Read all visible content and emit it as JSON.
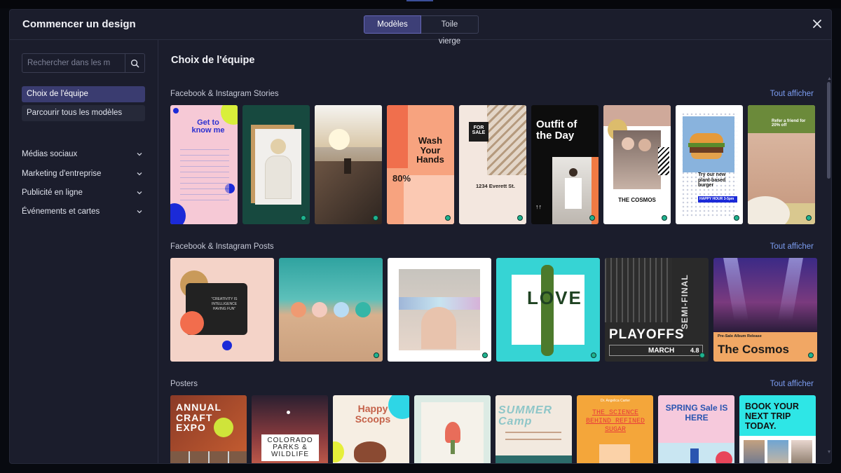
{
  "modal": {
    "title": "Commencer un design",
    "tabs": [
      "Modèles",
      "Toile vierge"
    ]
  },
  "sidebar": {
    "search_placeholder": "Rechercher dans les m",
    "items": [
      "Choix de l'équipe",
      "Parcourir tous les modèles"
    ],
    "categories": [
      "Médias sociaux",
      "Marketing d'entreprise",
      "Publicité en ligne",
      "Événements et cartes"
    ]
  },
  "main": {
    "title": "Choix de l'équipe",
    "see_all": "Tout afficher",
    "sections": [
      {
        "title": "Facebook & Instagram Stories"
      },
      {
        "title": "Facebook & Instagram Posts"
      },
      {
        "title": "Posters"
      }
    ],
    "stories": {
      "get_to_know": "Get to know me",
      "wash": "Wash Your Hands",
      "wash_pct": "80%",
      "for_sale": "FOR SALE",
      "address": "1234 Everett St.",
      "outfit": "Outfit of the Day",
      "cosmos": "THE COSMOS",
      "burger": "Try our new plant-based burger",
      "burger_sub": "HAPPY HOUR 3-5pm",
      "massage": "Refer a friend for 20% off"
    },
    "posts": {
      "creativity": "\"CREATIVITY IS INTELLIGENCE HAVING FUN\"",
      "love": "LOVE",
      "semi": "SEMI-FINAL",
      "playoffs": "PLAYOFFS",
      "march": "MARCH",
      "march_day": "4.8",
      "cosmos_pre": "Pre-Sale Album Release",
      "cosmos": "The Cosmos"
    },
    "posters": {
      "craft": "ANNUAL CRAFT EXPO",
      "colorado": "COLORADO PARKS & WILDLIFE",
      "scoops": "Happy Scoops",
      "summer": "SUMMER Camp",
      "science_by": "Dr. Angelica Carter",
      "science": "THE SCIENCE BEHIND REFINED SUGAR",
      "spring": "SPRING Sale IS HERE",
      "trip": "BOOK YOUR NEXT TRIP TODAY."
    }
  }
}
